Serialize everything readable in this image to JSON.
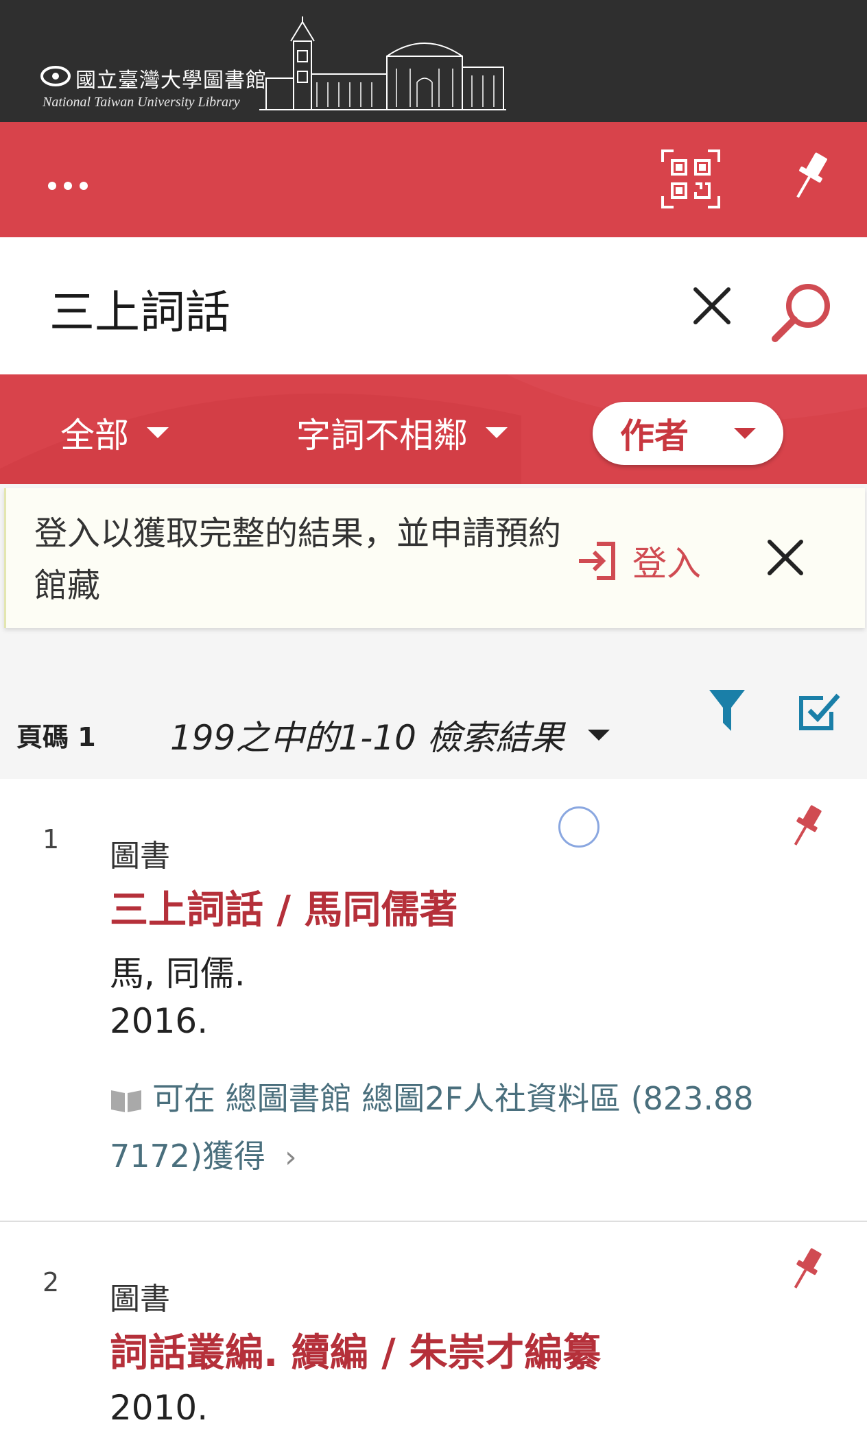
{
  "header": {
    "logo_zh": "國立臺灣大學圖書館",
    "logo_en": "National Taiwan University Library"
  },
  "toolbar": {
    "more_icon": "more-horizontal-icon",
    "qr_icon": "qr-code-scan-icon",
    "pin_icon": "pin-icon"
  },
  "search": {
    "query": "三上詞話",
    "clear_icon": "close-icon",
    "search_icon": "search-icon"
  },
  "filters": {
    "scope": "全部",
    "match": "字詞不相鄰",
    "field": "作者"
  },
  "login_banner": {
    "message": "登入以獲取完整的結果，並申請預約館藏",
    "login_label": "登入",
    "login_icon": "sign-in-icon",
    "close_icon": "close-icon"
  },
  "results_header": {
    "page_label": "頁碼 1",
    "count_label": "199之中的1-10 檢索結果",
    "filter_icon": "funnel-icon",
    "select_icon": "checkbox-checked-icon"
  },
  "results": [
    {
      "number": "1",
      "type": "圖書",
      "title": "三上詞話 / 馬同儒著",
      "author": "馬, 同儒.",
      "year": "2016.",
      "availability": "可在 總圖書館  總圖2F人社資料區 (823.88 7172)獲得"
    },
    {
      "number": "2",
      "type": "圖書",
      "title": "詞話叢編. 續編 / 朱崇才編纂",
      "year": "2010."
    }
  ],
  "colors": {
    "header_dark": "#2f2f2f",
    "brand_red": "#d8434b",
    "title_red": "#b5303a",
    "availability_teal": "#4a6f7d",
    "icon_blue": "#1a7fa8"
  }
}
